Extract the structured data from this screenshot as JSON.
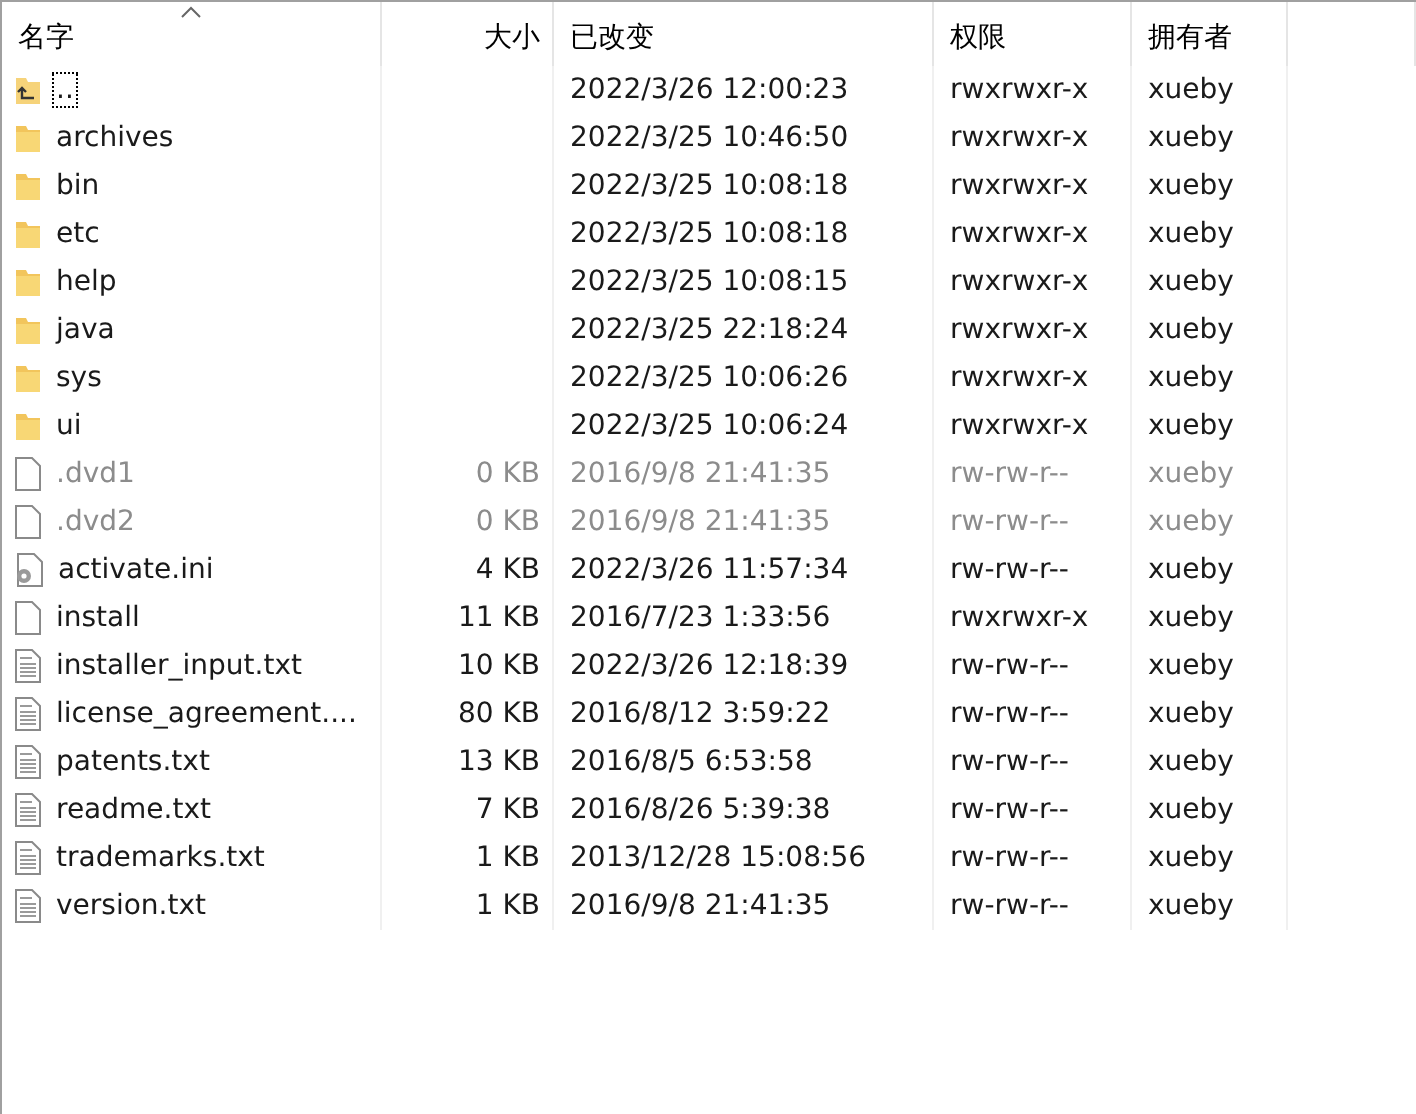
{
  "columns": [
    {
      "label": "名字",
      "sorted": true
    },
    {
      "label": "大小",
      "sorted": false
    },
    {
      "label": "已改变",
      "sorted": false
    },
    {
      "label": "权限",
      "sorted": false
    },
    {
      "label": "拥有者",
      "sorted": false
    }
  ],
  "rows": [
    {
      "kind": "parent",
      "name": "..",
      "size": "",
      "modified": "2022/3/26 12:00:23",
      "permissions": "rwxrwxr-x",
      "owner": "xueby",
      "hidden": false,
      "focused": true
    },
    {
      "kind": "folder",
      "name": "archives",
      "size": "",
      "modified": "2022/3/25 10:46:50",
      "permissions": "rwxrwxr-x",
      "owner": "xueby",
      "hidden": false,
      "focused": false
    },
    {
      "kind": "folder",
      "name": "bin",
      "size": "",
      "modified": "2022/3/25 10:08:18",
      "permissions": "rwxrwxr-x",
      "owner": "xueby",
      "hidden": false,
      "focused": false
    },
    {
      "kind": "folder",
      "name": "etc",
      "size": "",
      "modified": "2022/3/25 10:08:18",
      "permissions": "rwxrwxr-x",
      "owner": "xueby",
      "hidden": false,
      "focused": false
    },
    {
      "kind": "folder",
      "name": "help",
      "size": "",
      "modified": "2022/3/25 10:08:15",
      "permissions": "rwxrwxr-x",
      "owner": "xueby",
      "hidden": false,
      "focused": false
    },
    {
      "kind": "folder",
      "name": "java",
      "size": "",
      "modified": "2022/3/25 22:18:24",
      "permissions": "rwxrwxr-x",
      "owner": "xueby",
      "hidden": false,
      "focused": false
    },
    {
      "kind": "folder",
      "name": "sys",
      "size": "",
      "modified": "2022/3/25 10:06:26",
      "permissions": "rwxrwxr-x",
      "owner": "xueby",
      "hidden": false,
      "focused": false
    },
    {
      "kind": "folder",
      "name": "ui",
      "size": "",
      "modified": "2022/3/25 10:06:24",
      "permissions": "rwxrwxr-x",
      "owner": "xueby",
      "hidden": false,
      "focused": false
    },
    {
      "kind": "file",
      "name": ".dvd1",
      "size": "0 KB",
      "modified": "2016/9/8 21:41:35",
      "permissions": "rw-rw-r--",
      "owner": "xueby",
      "hidden": true,
      "focused": false
    },
    {
      "kind": "file",
      "name": ".dvd2",
      "size": "0 KB",
      "modified": "2016/9/8 21:41:35",
      "permissions": "rw-rw-r--",
      "owner": "xueby",
      "hidden": true,
      "focused": false
    },
    {
      "kind": "settings",
      "name": "activate.ini",
      "size": "4 KB",
      "modified": "2022/3/26 11:57:34",
      "permissions": "rw-rw-r--",
      "owner": "xueby",
      "hidden": false,
      "focused": false
    },
    {
      "kind": "file",
      "name": "install",
      "size": "11 KB",
      "modified": "2016/7/23 1:33:56",
      "permissions": "rwxrwxr-x",
      "owner": "xueby",
      "hidden": false,
      "focused": false
    },
    {
      "kind": "text",
      "name": "installer_input.txt",
      "size": "10 KB",
      "modified": "2022/3/26 12:18:39",
      "permissions": "rw-rw-r--",
      "owner": "xueby",
      "hidden": false,
      "focused": false
    },
    {
      "kind": "text",
      "name": "license_agreement....",
      "size": "80 KB",
      "modified": "2016/8/12 3:59:22",
      "permissions": "rw-rw-r--",
      "owner": "xueby",
      "hidden": false,
      "focused": false
    },
    {
      "kind": "text",
      "name": "patents.txt",
      "size": "13 KB",
      "modified": "2016/8/5 6:53:58",
      "permissions": "rw-rw-r--",
      "owner": "xueby",
      "hidden": false,
      "focused": false
    },
    {
      "kind": "text",
      "name": "readme.txt",
      "size": "7 KB",
      "modified": "2016/8/26 5:39:38",
      "permissions": "rw-rw-r--",
      "owner": "xueby",
      "hidden": false,
      "focused": false
    },
    {
      "kind": "text",
      "name": "trademarks.txt",
      "size": "1 KB",
      "modified": "2013/12/28 15:08:56",
      "permissions": "rw-rw-r--",
      "owner": "xueby",
      "hidden": false,
      "focused": false
    },
    {
      "kind": "text",
      "name": "version.txt",
      "size": "1 KB",
      "modified": "2016/9/8 21:41:35",
      "permissions": "rw-rw-r--",
      "owner": "xueby",
      "hidden": false,
      "focused": false
    }
  ]
}
